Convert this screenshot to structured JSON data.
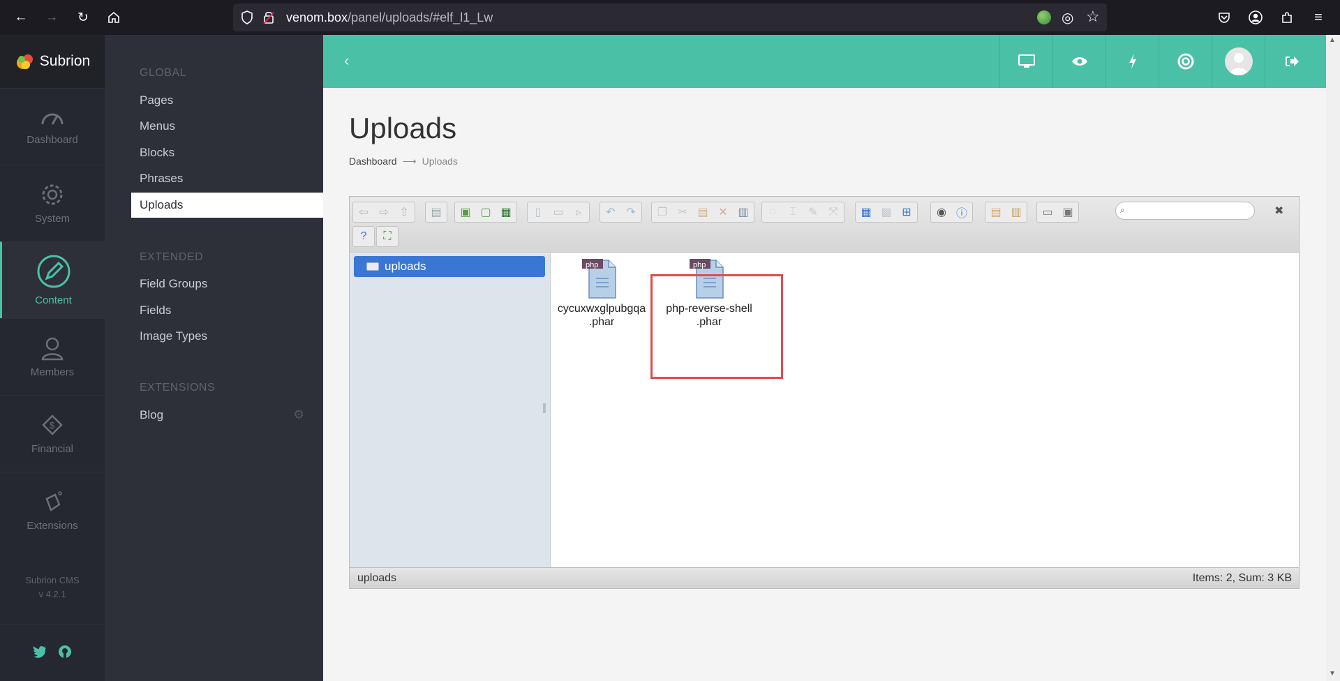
{
  "browser": {
    "url_host": "venom.box",
    "url_path": "/panel/uploads/#elf_l1_Lw"
  },
  "brand": {
    "name": "Subrion"
  },
  "rail": {
    "items": [
      {
        "label": "Dashboard"
      },
      {
        "label": "System"
      },
      {
        "label": "Content"
      },
      {
        "label": "Members"
      },
      {
        "label": "Financial"
      },
      {
        "label": "Extensions"
      }
    ],
    "cms_name": "Subrion CMS",
    "cms_version": "v 4.2.1"
  },
  "submenu": {
    "global_heading": "GLOBAL",
    "global_items": [
      "Pages",
      "Menus",
      "Blocks",
      "Phrases",
      "Uploads"
    ],
    "extended_heading": "EXTENDED",
    "extended_items": [
      "Field Groups",
      "Fields",
      "Image Types"
    ],
    "extensions_heading": "EXTENSIONS",
    "extensions_items": [
      "Blog"
    ]
  },
  "page": {
    "title": "Uploads",
    "breadcrumb_root": "Dashboard",
    "breadcrumb_sep": "⟶",
    "breadcrumb_current": "Uploads"
  },
  "file_manager": {
    "tree_root": "uploads",
    "files": [
      {
        "name_line1": "cycuxwxglpubgqa",
        "name_line2": ".phar",
        "badge": "php"
      },
      {
        "name_line1": "php-reverse-shell",
        "name_line2": ".phar",
        "badge": "php"
      }
    ],
    "status_path": "uploads",
    "status_summary": "Items: 2, Sum: 3 KB"
  },
  "colors": {
    "accent": "#4ac0a7",
    "selection": "#3a77d4",
    "highlight": "#e24b4b"
  }
}
